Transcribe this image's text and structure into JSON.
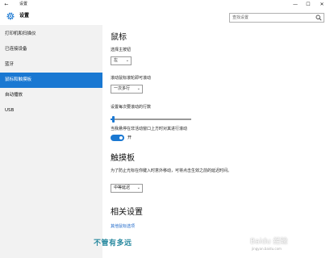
{
  "window": {
    "title": "设置",
    "back_glyph": "←",
    "min_glyph": "—",
    "max_glyph": "☐",
    "close_glyph": "✕"
  },
  "header": {
    "app_name": "设置",
    "search_placeholder": "查找设置"
  },
  "sidebar": {
    "items": [
      {
        "label": "打印机和扫描仪",
        "active": false
      },
      {
        "label": "已连接设备",
        "active": false
      },
      {
        "label": "蓝牙",
        "active": false
      },
      {
        "label": "鼠标和触摸板",
        "active": true
      },
      {
        "label": "自动播放",
        "active": false
      },
      {
        "label": "USB",
        "active": false
      }
    ]
  },
  "mouse": {
    "heading": "鼠标",
    "primary_button_label": "选择主按钮",
    "primary_button_value": "左",
    "scroll_label": "滚动鼠标滚轮即可滚动",
    "scroll_value": "一次多行",
    "lines_label": "设置每次要滚动的行数",
    "lines_level": 0.03,
    "inactive_scroll_label": "当我悬停在非活动窗口上方时对其进行滚动",
    "inactive_scroll_state": "开",
    "inactive_scroll_on": true
  },
  "touchpad": {
    "heading": "触摸板",
    "delay_label": "为了防止光标在你键入时意外移动，可将点击生效之前的延迟时间。",
    "delay_value": "中等延迟"
  },
  "related": {
    "heading": "相关设置",
    "link": "其他鼠标选项"
  },
  "watermark": {
    "left": "不管有多远",
    "right": "Baidu 经验",
    "right_sub": "jingyan.baidu.com"
  },
  "colors": {
    "accent": "#1a78d2",
    "sidebar_bg": "#f2f2f2",
    "link": "#1a66c8"
  }
}
